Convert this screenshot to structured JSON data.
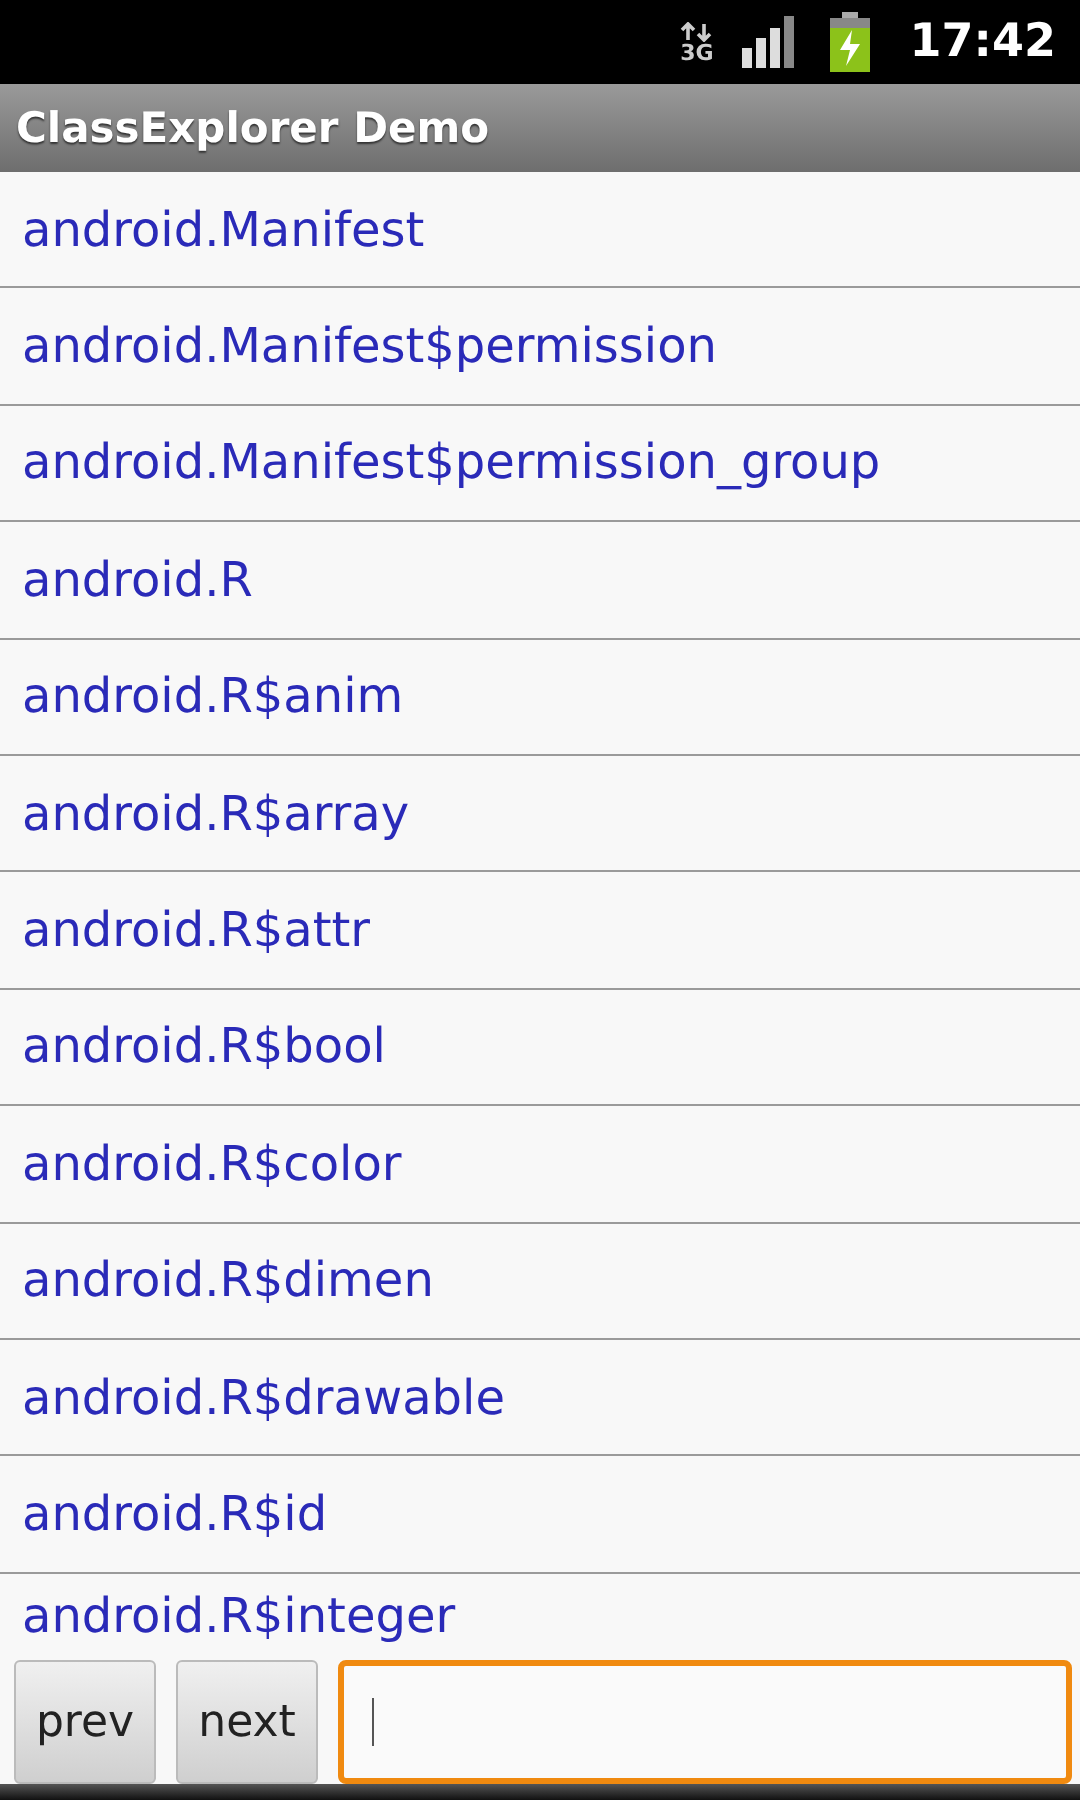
{
  "status_bar": {
    "network_type": "3G",
    "time": "17:42"
  },
  "title_bar": {
    "title": "ClassExplorer Demo"
  },
  "list": {
    "items": [
      {
        "label": "android.Manifest"
      },
      {
        "label": "android.Manifest$permission"
      },
      {
        "label": "android.Manifest$permission_group"
      },
      {
        "label": "android.R"
      },
      {
        "label": "android.R$anim"
      },
      {
        "label": "android.R$array"
      },
      {
        "label": "android.R$attr"
      },
      {
        "label": "android.R$bool"
      },
      {
        "label": "android.R$color"
      },
      {
        "label": "android.R$dimen"
      },
      {
        "label": "android.R$drawable"
      },
      {
        "label": "android.R$id"
      },
      {
        "label": "android.R$integer"
      }
    ]
  },
  "bottom_bar": {
    "buttons": [
      {
        "label": "prev"
      },
      {
        "label": "next"
      }
    ],
    "search_input": {
      "focused": true
    }
  }
}
